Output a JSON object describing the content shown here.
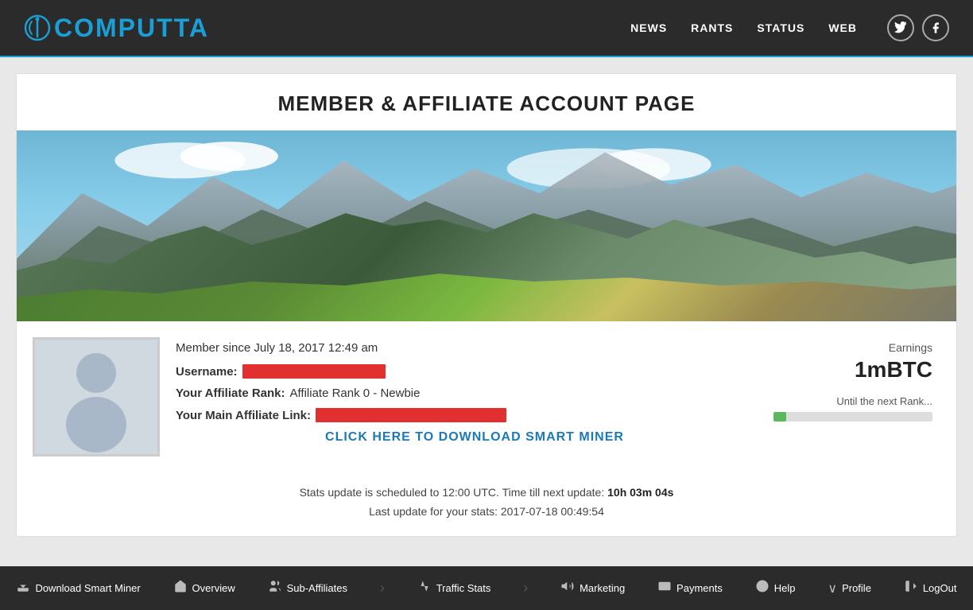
{
  "header": {
    "logo_text": "COMPUTTA",
    "nav_items": [
      {
        "label": "NEWS",
        "id": "news"
      },
      {
        "label": "RANTS",
        "id": "rants"
      },
      {
        "label": "STATUS",
        "id": "status"
      },
      {
        "label": "WEB",
        "id": "web"
      }
    ],
    "social": {
      "twitter": "𝕏",
      "facebook": "f"
    }
  },
  "page": {
    "title": "MEMBER & AFFILIATE ACCOUNT PAGE"
  },
  "profile": {
    "member_since": "Member since July 18, 2017 12:49 am",
    "username_label": "Username:",
    "affiliate_rank_label": "Your Affiliate Rank:",
    "affiliate_rank_value": "Affiliate Rank 0 - Newbie",
    "affiliate_link_label": "Your Main Affiliate Link:",
    "download_link_text": "CLICK HERE TO DOWNLOAD SMART MINER"
  },
  "earnings": {
    "label": "Earnings",
    "value": "1mBTC",
    "rank_progress_label": "Until the next Rank...",
    "progress_percent": 8
  },
  "stats": {
    "update_text": "Stats update is scheduled to 12:00 UTC. Time till next update:",
    "countdown": "10h 03m 04s",
    "last_update_text": "Last update for your stats: 2017-07-18 00:49:54"
  },
  "bottom_nav": {
    "items": [
      {
        "icon": "⬇",
        "label": "Download Smart Miner",
        "id": "download"
      },
      {
        "icon": "⌂",
        "label": "Overview",
        "id": "overview"
      },
      {
        "icon": "≡",
        "label": "Sub-Affiliates",
        "id": "sub-affiliates"
      },
      {
        "icon": "›",
        "label": "Traffic Stats",
        "id": "traffic-stats"
      },
      {
        "icon": "›",
        "label": "Marketing",
        "id": "marketing"
      },
      {
        "icon": "◉",
        "label": "Payments",
        "id": "payments"
      },
      {
        "icon": "?",
        "label": "Help",
        "id": "help"
      },
      {
        "icon": "∨",
        "label": "Profile",
        "id": "profile"
      },
      {
        "icon": "↪",
        "label": "LogOut",
        "id": "logout"
      }
    ]
  }
}
